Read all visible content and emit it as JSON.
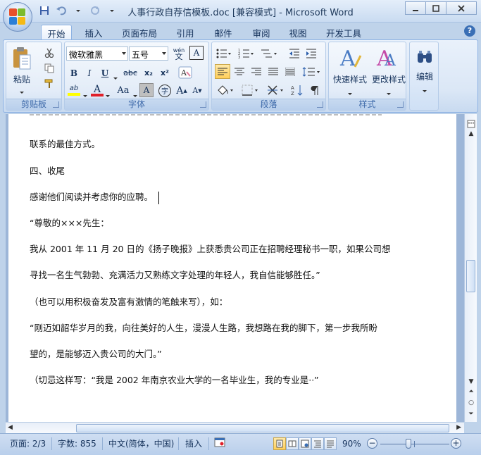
{
  "window": {
    "title": "人事行政自荐信模板.doc [兼容模式] - Microsoft Word"
  },
  "tabs": [
    "开始",
    "插入",
    "页面布局",
    "引用",
    "邮件",
    "审阅",
    "视图",
    "开发工具"
  ],
  "ribbon": {
    "clipboard": {
      "label": "剪贴板",
      "paste": "粘贴"
    },
    "font": {
      "label": "字体",
      "font_name": "微软雅黑",
      "font_size": "五号",
      "wen": "wén",
      "wen_char": "文",
      "a_box": "A",
      "bold": "B",
      "italic": "I",
      "underline": "U",
      "strike": "abc",
      "subscript": "x₂",
      "superscript": "x²",
      "clear": "A",
      "highlight": "ab",
      "font_color": "A",
      "change_case": "Aa",
      "char_shade": "A",
      "enclose": "字",
      "grow": "A",
      "shrink": "A"
    },
    "paragraph": {
      "label": "段落"
    },
    "styles": {
      "label": "样式",
      "quick": "快速样式",
      "change": "更改样式"
    },
    "editing": {
      "label": "编辑"
    }
  },
  "document": {
    "lines": [
      "联系的最佳方式。",
      "四、收尾",
      "感谢他们阅读并考虑你的应聘。",
      "“尊敬的×××先生：",
      "我从 2001 年 11 月 20 日的《扬子晚报》上获悉贵公司正在招聘经理秘书一职，如果公司想",
      "寻找一名生气勃勃、充满活力又熟练文字处理的年轻人，我自信能够胜任。”",
      "（也可以用积极奋发及富有激情的笔触来写），如：",
      "“刚迈如韶华岁月的我，向往美好的人生，漫漫人生路，我想路在我的脚下，第一步我所盼",
      "望的，是能够迈入贵公司的大门。”",
      "（切忌这样写：“我是 2002 年南京农业大学的一名毕业生，我的专业是··”"
    ]
  },
  "status": {
    "page": "页面: 2/3",
    "words": "字数: 855",
    "lang": "中文(简体，中国)",
    "mode": "插入",
    "zoom": "90%",
    "zoom_percent": 90
  },
  "colors": {
    "font_color_bar": "#e0202a",
    "highlight_bar": "#ffff00"
  }
}
